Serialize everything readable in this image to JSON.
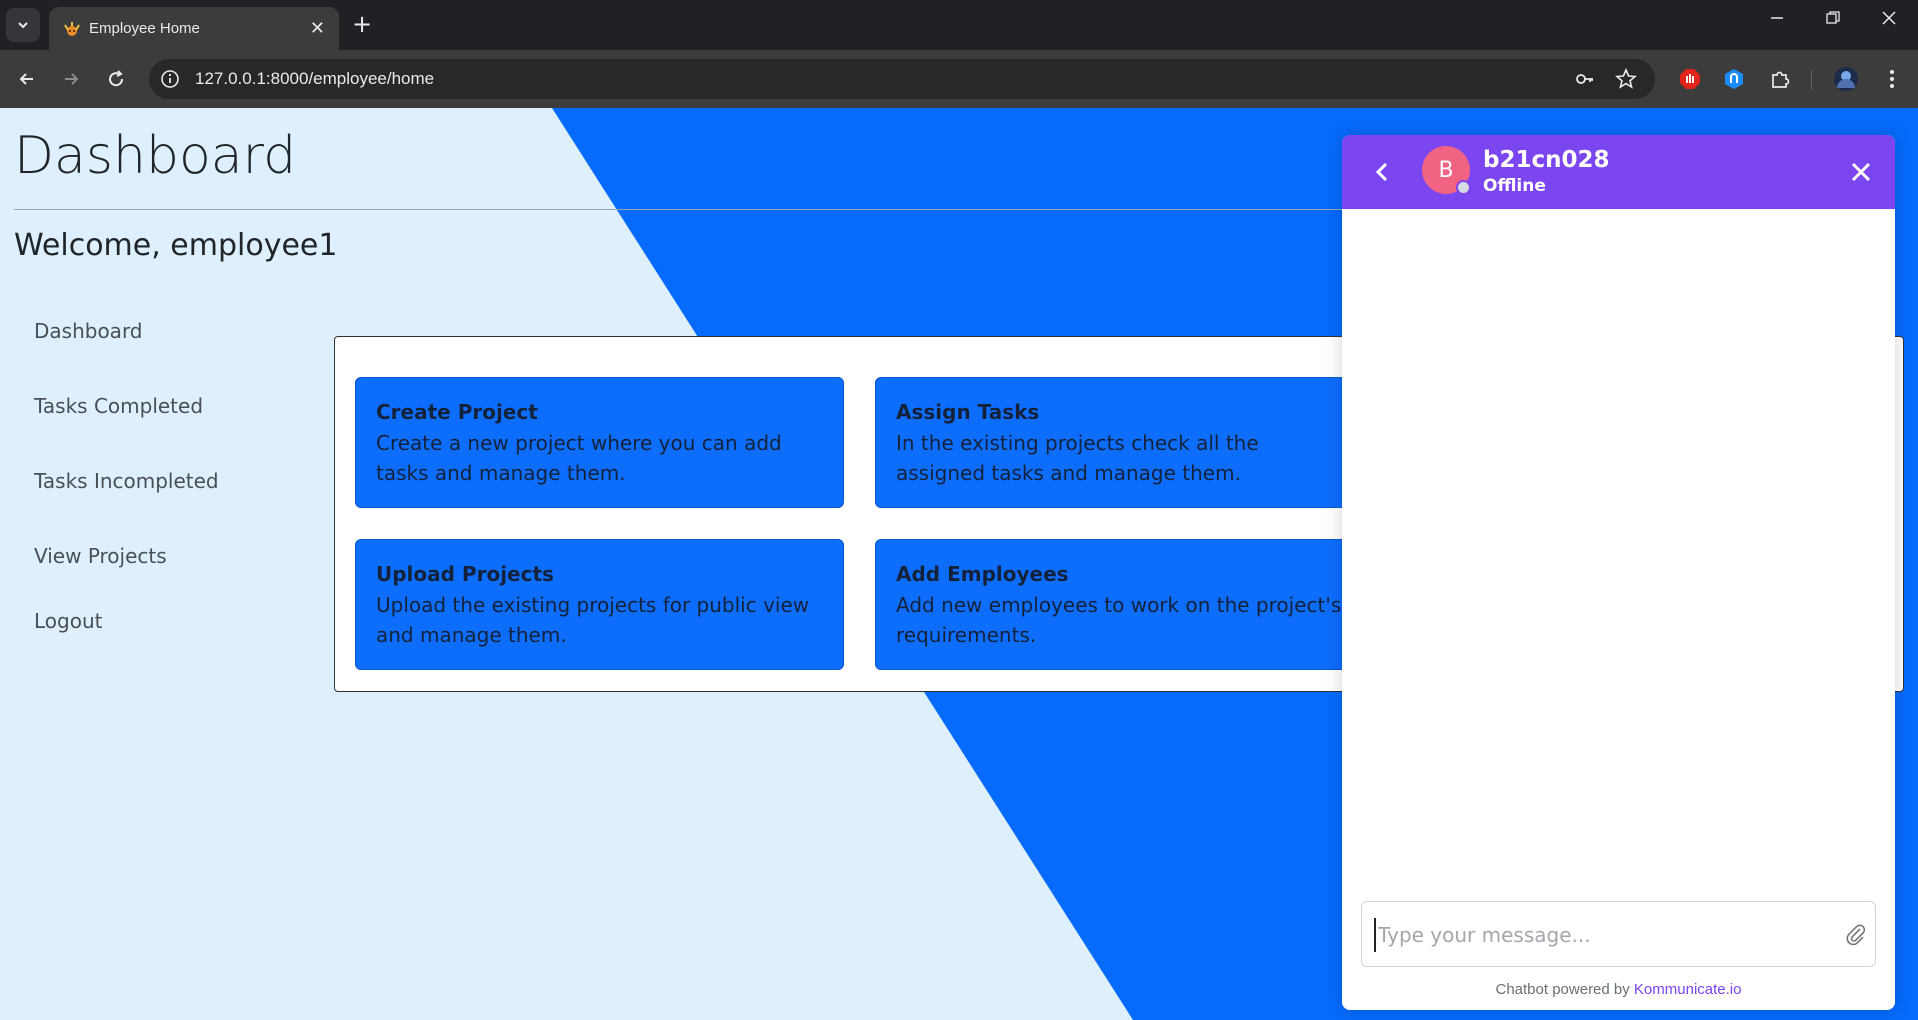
{
  "browser": {
    "tab_title": "Employee Home",
    "url": "127.0.0.1:8000/employee/home",
    "url_host": "127.0.0.1",
    "url_rest": ":8000/employee/home"
  },
  "page": {
    "title": "Dashboard",
    "welcome": "Welcome, employee1"
  },
  "sidebar": {
    "items": [
      {
        "label": "Dashboard"
      },
      {
        "label": "Tasks Completed"
      },
      {
        "label": "Tasks Incompleted"
      },
      {
        "label": "View Projects"
      },
      {
        "label": "Logout"
      }
    ]
  },
  "cards": [
    {
      "title": "Create Project",
      "text": "Create a new project where you can add tasks and manage them."
    },
    {
      "title": "Assign Tasks",
      "text": "In the existing projects check all the assigned tasks and manage them."
    },
    {
      "title": "Upload Projects",
      "text": "Upload the existing projects for public view and manage them."
    },
    {
      "title": "Add Employees",
      "text": "Add new employees to work on the project's requirements."
    }
  ],
  "chat": {
    "avatar_letter": "B",
    "name": "b21cn028",
    "status": "Offline",
    "placeholder": "Type your message...",
    "footer_prefix": "Chatbot powered by ",
    "footer_link": "Kommunicate.io"
  },
  "colors": {
    "page_bg": "#deeffe",
    "accent_blue": "#0d6efd",
    "chat_header": "#7b45f0",
    "avatar": "#f06383"
  }
}
